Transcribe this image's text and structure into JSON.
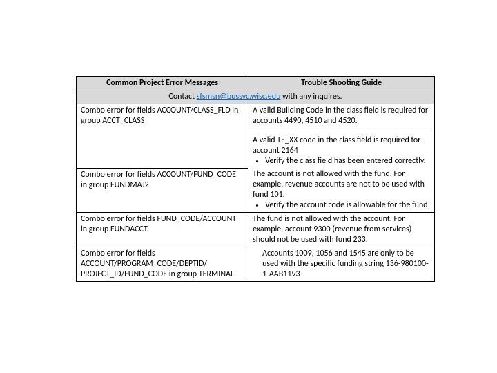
{
  "headers": {
    "left": "Common Project Error Messages",
    "right": "Trouble Shooting Guide"
  },
  "contact": {
    "prefix": "Contact ",
    "email": "sfsmsn@bussvc.wisc.edu",
    "suffix": " with any inquires."
  },
  "rows": [
    {
      "error": "Combo error for fields ACCOUNT/CLASS_FLD in group ACCT_CLASS",
      "guide_intro": "A valid Building Code in the class field is required for accounts 4490, 4510 and 4520.",
      "guide_extra": "A valid TE_XX code in the class field is required for account 2164",
      "bullet": "Verify the class field has been entered correctly."
    },
    {
      "error": "Combo error for fields ACCOUNT/FUND_CODE in group FUNDMAJ2",
      "guide_intro": "The account is not allowed with the fund. For example, revenue accounts are not to be used with fund 101.",
      "bullet": "Verify the account code is allowable for the fund"
    },
    {
      "error": "Combo error for fields FUND_CODE/ACCOUNT in group FUNDACCT.",
      "guide_intro": "The fund is not allowed with the account. For example, account 9300 (revenue from services) should not be used with fund 233."
    },
    {
      "error": "Combo error for fields ACCOUNT/PROGRAM_CODE/DEPTID/ PROJECT_ID/FUND_CODE in group TERMINAL",
      "guide_intro": "Accounts 1009, 1056 and 1545 are only to be used with the specific funding string 136-980100-1-AAB1193"
    }
  ]
}
